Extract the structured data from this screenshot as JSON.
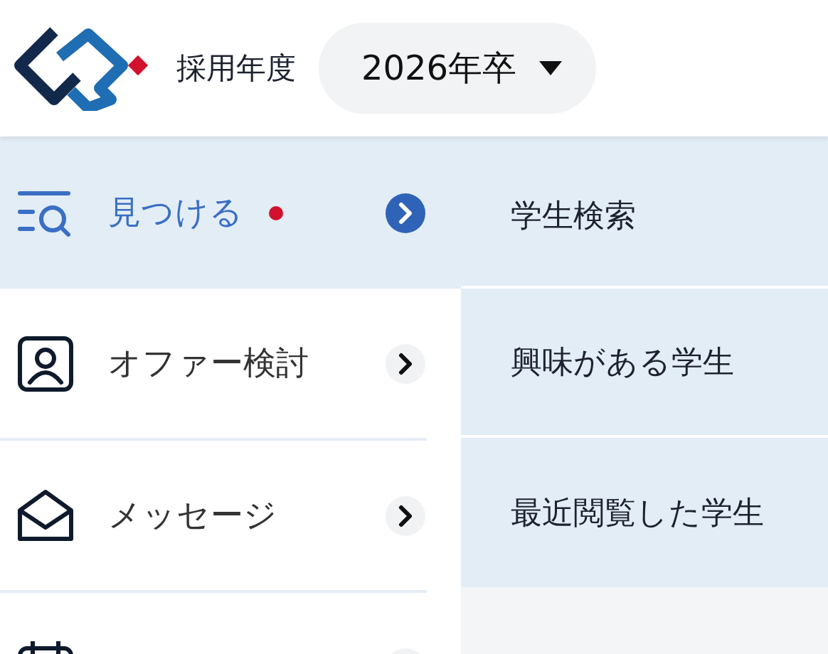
{
  "header": {
    "label": "採用年度",
    "year_select": {
      "value": "2026年卒"
    }
  },
  "nav_items": [
    {
      "kind": "find",
      "label": "見つける",
      "selected": true,
      "badge": true
    },
    {
      "kind": "offer",
      "label": "オファー検討",
      "selected": false,
      "badge": false
    },
    {
      "kind": "message",
      "label": "メッセージ",
      "selected": false,
      "badge": false
    },
    {
      "kind": "schedule",
      "selected": false
    }
  ],
  "submenu": [
    {
      "label": "学生検索"
    },
    {
      "label": "興味がある学生"
    },
    {
      "label": "最近閲覧した学生"
    }
  ]
}
